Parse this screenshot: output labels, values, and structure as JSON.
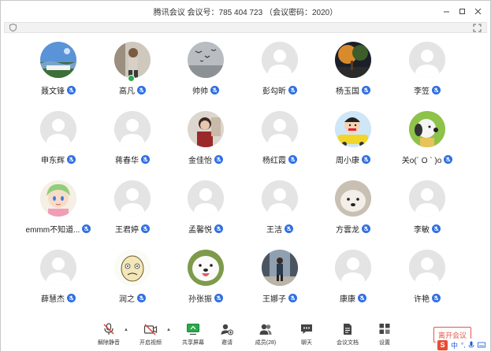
{
  "window": {
    "title": "腾讯会议  会议号：785 404 723 （会议密码：2020）"
  },
  "participants": [
    {
      "name": "聂文锋",
      "avatar": "photo-sky"
    },
    {
      "name": "高凡",
      "avatar": "photo-person",
      "host": true
    },
    {
      "name": "帅帅",
      "avatar": "photo-birds"
    },
    {
      "name": "彭勾昕",
      "avatar": "default"
    },
    {
      "name": "杨玉国",
      "avatar": "photo-trees"
    },
    {
      "name": "李笠",
      "avatar": "default"
    },
    {
      "name": "申东辉",
      "avatar": "default"
    },
    {
      "name": "蒋春华",
      "avatar": "default"
    },
    {
      "name": "金佳怡",
      "avatar": "photo-girl"
    },
    {
      "name": "杨红霞",
      "avatar": "default"
    },
    {
      "name": "周小康",
      "avatar": "cartoon-boy"
    },
    {
      "name": "关o(´ O ` )o",
      "avatar": "cartoon-snoopy"
    },
    {
      "name": "emmm不知道...",
      "avatar": "cartoon-anime"
    },
    {
      "name": "王君婷",
      "avatar": "default"
    },
    {
      "name": "孟馨悦",
      "avatar": "default"
    },
    {
      "name": "王洁",
      "avatar": "default"
    },
    {
      "name": "方雲龙",
      "avatar": "photo-dog"
    },
    {
      "name": "李敏",
      "avatar": "default"
    },
    {
      "name": "薛慧杰",
      "avatar": "default"
    },
    {
      "name": "润之",
      "avatar": "cartoon-face"
    },
    {
      "name": "孙张振",
      "avatar": "photo-samoyed"
    },
    {
      "name": "王娜子",
      "avatar": "photo-street"
    },
    {
      "name": "康康",
      "avatar": "default"
    },
    {
      "name": "许艳",
      "avatar": "default"
    }
  ],
  "toolbar": {
    "unmute": "解除静音",
    "start_video": "开启视频",
    "share_screen": "共享屏幕",
    "invite": "邀请",
    "members": "成员(28)",
    "chat": "聊天",
    "docs": "会议文档",
    "settings": "设置"
  },
  "leave_label": "离开会议",
  "ime": {
    "mode": "中",
    "punct": "°,"
  },
  "colors": {
    "accent": "#2f6fe4",
    "leave": "#e05a4b",
    "host_badge": "#2aa84a"
  }
}
